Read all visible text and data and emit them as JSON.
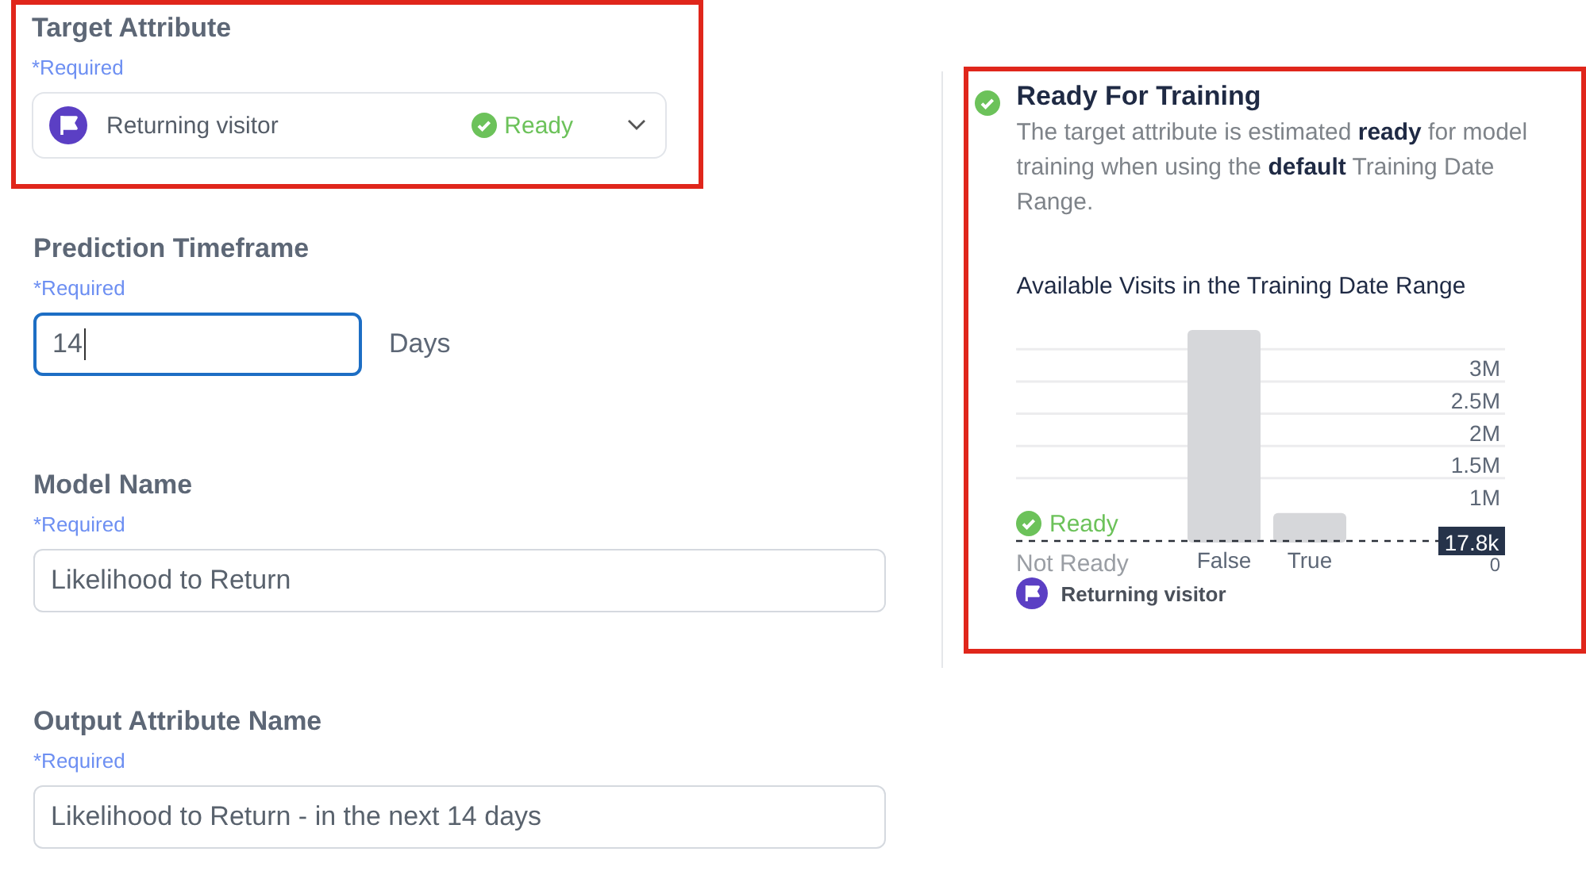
{
  "form": {
    "fields": [
      {
        "kind": "select",
        "label": "Target Attribute",
        "required": "*Required",
        "value": "Returning visitor",
        "status": "Ready",
        "highlighted": true
      },
      {
        "kind": "number",
        "label": "Prediction Timeframe",
        "required": "*Required",
        "value": "14",
        "unit": "Days",
        "focused": true
      },
      {
        "kind": "text",
        "label": "Model Name",
        "required": "*Required",
        "value": "Likelihood to Return",
        "focused": false
      },
      {
        "kind": "text",
        "label": "Output Attribute Name",
        "required": "*Required",
        "value": "Likelihood to Return - in the next 14 days",
        "focused": false
      }
    ]
  },
  "readiness": {
    "highlighted": true,
    "title": "Ready For Training",
    "description": "The target attribute is estimated **ready** for model training when using the **default** Training Date Range.",
    "chart_title": "Available Visits in the Training Date Range",
    "chart_data": {
      "type": "bar",
      "categories": [
        "False",
        "True"
      ],
      "values": [
        3300000,
        460000
      ],
      "yticks": [
        {
          "value": 0,
          "label": "0"
        },
        {
          "value": 1000000,
          "label": "1M"
        },
        {
          "value": 1500000,
          "label": "1.5M"
        },
        {
          "value": 2000000,
          "label": "2M"
        },
        {
          "value": 2500000,
          "label": "2.5M"
        },
        {
          "value": 3000000,
          "label": "3M"
        }
      ],
      "ylim": [
        0,
        3300000
      ],
      "grid": true
    },
    "threshold_label": "17.8k",
    "above_label": "Ready",
    "below_label": "Not Ready",
    "legend": "Returning visitor"
  }
}
